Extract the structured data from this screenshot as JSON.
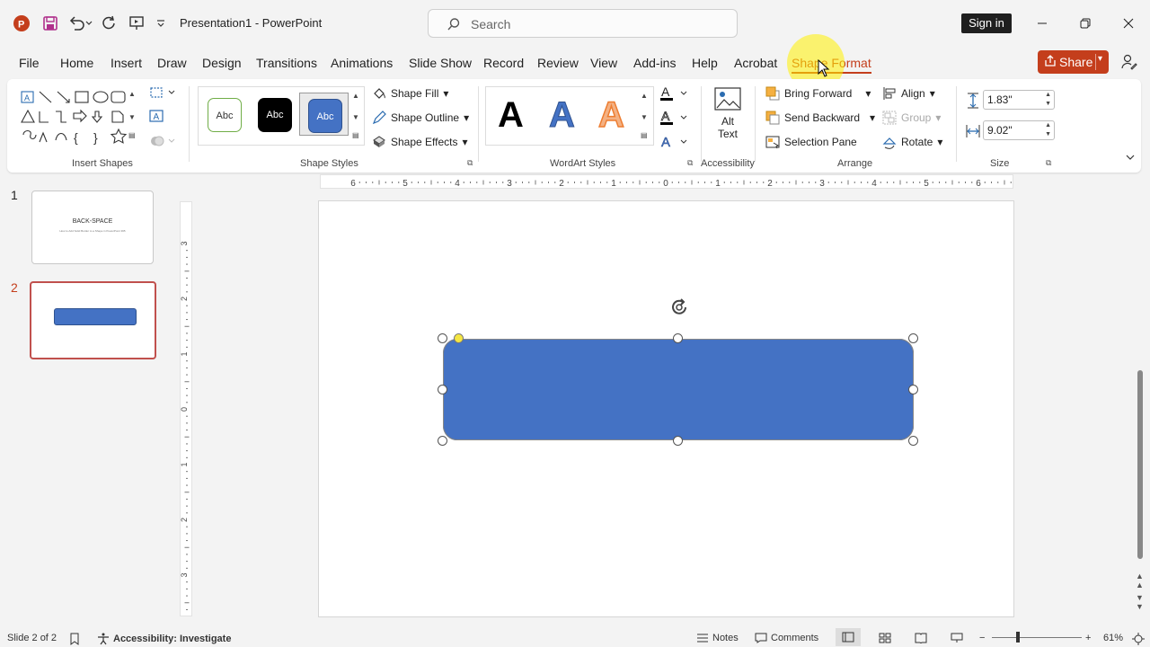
{
  "window": {
    "title": "Presentation1  -  PowerPoint",
    "search_placeholder": "Search",
    "signin_label": "Sign in",
    "share_label": "Share"
  },
  "tabs": [
    "File",
    "Home",
    "Insert",
    "Draw",
    "Design",
    "Transitions",
    "Animations",
    "Slide Show",
    "Record",
    "Review",
    "View",
    "Add-ins",
    "Help",
    "Acrobat",
    "Shape Format"
  ],
  "active_tab": "Shape Format",
  "ribbon": {
    "insert_shapes": {
      "label": "Insert Shapes"
    },
    "shape_styles": {
      "label": "Shape Styles",
      "swatch_text": [
        "Abc",
        "Abc",
        "Abc"
      ],
      "fill": "Shape Fill",
      "outline": "Shape Outline",
      "effects": "Shape Effects"
    },
    "wordart": {
      "label": "WordArt Styles",
      "letters": [
        "A",
        "A",
        "A"
      ]
    },
    "accessibility": {
      "label": "Accessibility",
      "alt_text_line1": "Alt",
      "alt_text_line2": "Text"
    },
    "arrange": {
      "label": "Arrange",
      "bring_forward": "Bring Forward",
      "send_backward": "Send Backward",
      "selection_pane": "Selection Pane",
      "align": "Align",
      "group": "Group",
      "rotate": "Rotate"
    },
    "size": {
      "label": "Size",
      "height": "1.83\"",
      "width": "9.02\""
    }
  },
  "slides_panel": {
    "slides": [
      {
        "number": "1",
        "title": "BACK-SPACE",
        "subtitle": "How to Add Solid Border to a Shape in PowerPoint 365"
      },
      {
        "number": "2"
      }
    ],
    "selected_slide": 2
  },
  "rulers": {
    "horizontal": [
      "6",
      "5",
      "4",
      "3",
      "2",
      "1",
      "0",
      "1",
      "2",
      "3",
      "4",
      "5",
      "6"
    ],
    "vertical": [
      "3",
      "2",
      "1",
      "0",
      "1",
      "2",
      "3"
    ]
  },
  "canvas": {
    "shape_fill": "#4472c4",
    "shape_kind": "rounded rectangle"
  },
  "status": {
    "slide_info": "Slide 2 of 2",
    "accessibility": "Accessibility: Investigate",
    "notes": "Notes",
    "comments": "Comments",
    "zoom": "61%"
  },
  "colors": {
    "accent": "#c43e1c",
    "shape_blue": "#4472c4",
    "selection_outline": "#c0504d"
  }
}
